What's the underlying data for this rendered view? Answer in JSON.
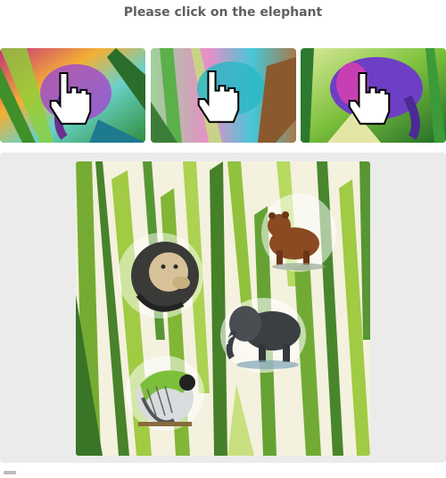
{
  "prompt": "Please click on the elephant",
  "examples": [
    {
      "icon": "hand-pointer-icon",
      "subject": "elephant"
    },
    {
      "icon": "hand-pointer-icon",
      "subject": "elephant"
    },
    {
      "icon": "hand-pointer-icon",
      "subject": "elephant"
    }
  ],
  "challenge": {
    "animals": [
      "lion",
      "bear",
      "elephant",
      "parrot"
    ]
  },
  "colors": {
    "prompt_text": "#5f5f5f",
    "panel_bg": "#ebebeb",
    "foliage": "#7cb32e"
  }
}
